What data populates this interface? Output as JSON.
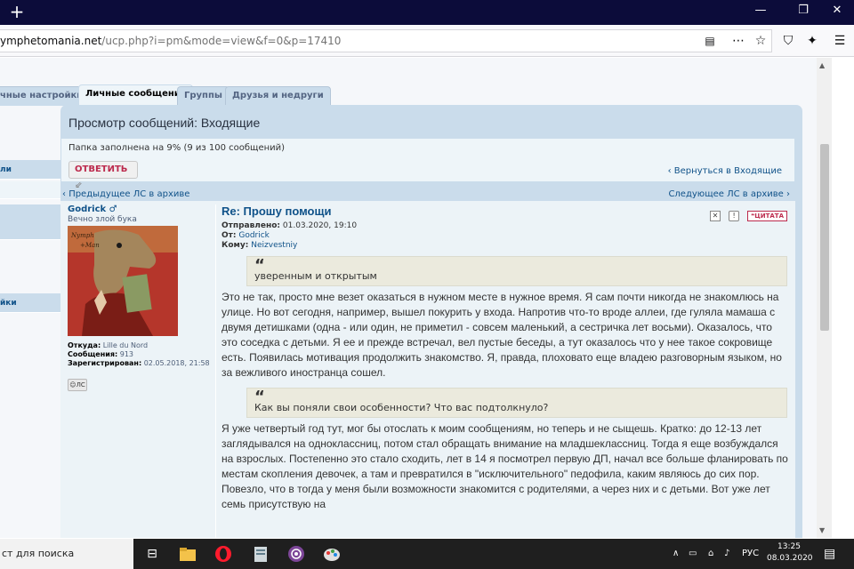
{
  "browser": {
    "url_host": "ymphetomania.net",
    "url_path": "/ucp.php?i=pm&mode=view&f=0&p=17410"
  },
  "tabs": [
    {
      "label": "чные настройки",
      "active": false
    },
    {
      "label": "Личные сообщения",
      "active": true
    },
    {
      "label": "Группы",
      "active": false
    },
    {
      "label": "Друзья и недруги",
      "active": false
    }
  ],
  "sidebar": {
    "items": [
      {
        "label": "ли"
      },
      {
        "label": ""
      },
      {
        "label": ""
      },
      {
        "label": "йки"
      }
    ]
  },
  "panel": {
    "title": "Просмотр сообщений: Входящие",
    "fill_info": "Папка заполнена на 9% (9 из 100 сообщений)",
    "reply_label": "ОТВЕТИТЬ",
    "back_label": "Вернуться в Входящие",
    "prev_label": "Предыдущее ЛС в архиве",
    "next_label": "Следующее ЛС в архиве"
  },
  "author": {
    "name": "Godrick",
    "gender_symbol": "♂",
    "rank": "Вечно злой бука",
    "from_label": "Откуда:",
    "from_value": "Lille du Nord",
    "posts_label": "Сообщения:",
    "posts_value": "913",
    "registered_label": "Зарегистрирован:",
    "registered_value": "02.05.2018, 21:58",
    "pm_label": "ЛС"
  },
  "message": {
    "subject": "Re: Прошу помощи",
    "sent_label": "Отправлено:",
    "sent_value": "01.03.2020, 19:10",
    "from_label": "От:",
    "from_value": "Godrick",
    "to_label": "Кому:",
    "to_value": "Neizvestniy",
    "quote_button": "ЦИТАТА",
    "quote1": "уверенным и открытым",
    "para1": "Это не так, просто мне везет оказаться в нужном месте в нужное время. Я сам почти никогда не знакомлюсь на улице. Но вот сегодня, например, вышел покурить у входа. Напротив что-то вроде аллеи, где гуляла мамаша с двумя детишками (одна - или один, не приметил - совсем маленький, а сестричка лет восьми). Оказалось, что это соседка с детьми. Я ее и прежде встречал, вел пустые беседы, а тут оказалось что у нее такое сокровище есть. Появилась мотивация продолжить знакомство. Я, правда, плоховато еще владею разговорным языком, но за вежливого иностранца сошел.",
    "quote2": "Как вы поняли свои особенности? Что вас подтолкнуло?",
    "para2": "Я уже четвертый год тут, мог бы отослать к моим сообщениям, но теперь и не сыщешь. Кратко: до 12-13 лет заглядывался на одноклассниц, потом стал обращать внимание на младшеклассниц. Тогда я еще возбуждался на взрослых. Постепенно это стало сходить, лет в 14 я посмотрел первую ДП, начал все больше фланировать по местам скопления девочек, а там и превратился в \"исключительного\" педофила, каким являюсь до сих пор. Повезло, что в тогда у меня были возможности знакомится с родителями, а через них и с детьми. Вот уже лет семь присутствую на"
  },
  "taskbar": {
    "search_text": "ст для поиска",
    "language": "РУС",
    "time": "13:25",
    "date": "08.03.2020"
  }
}
